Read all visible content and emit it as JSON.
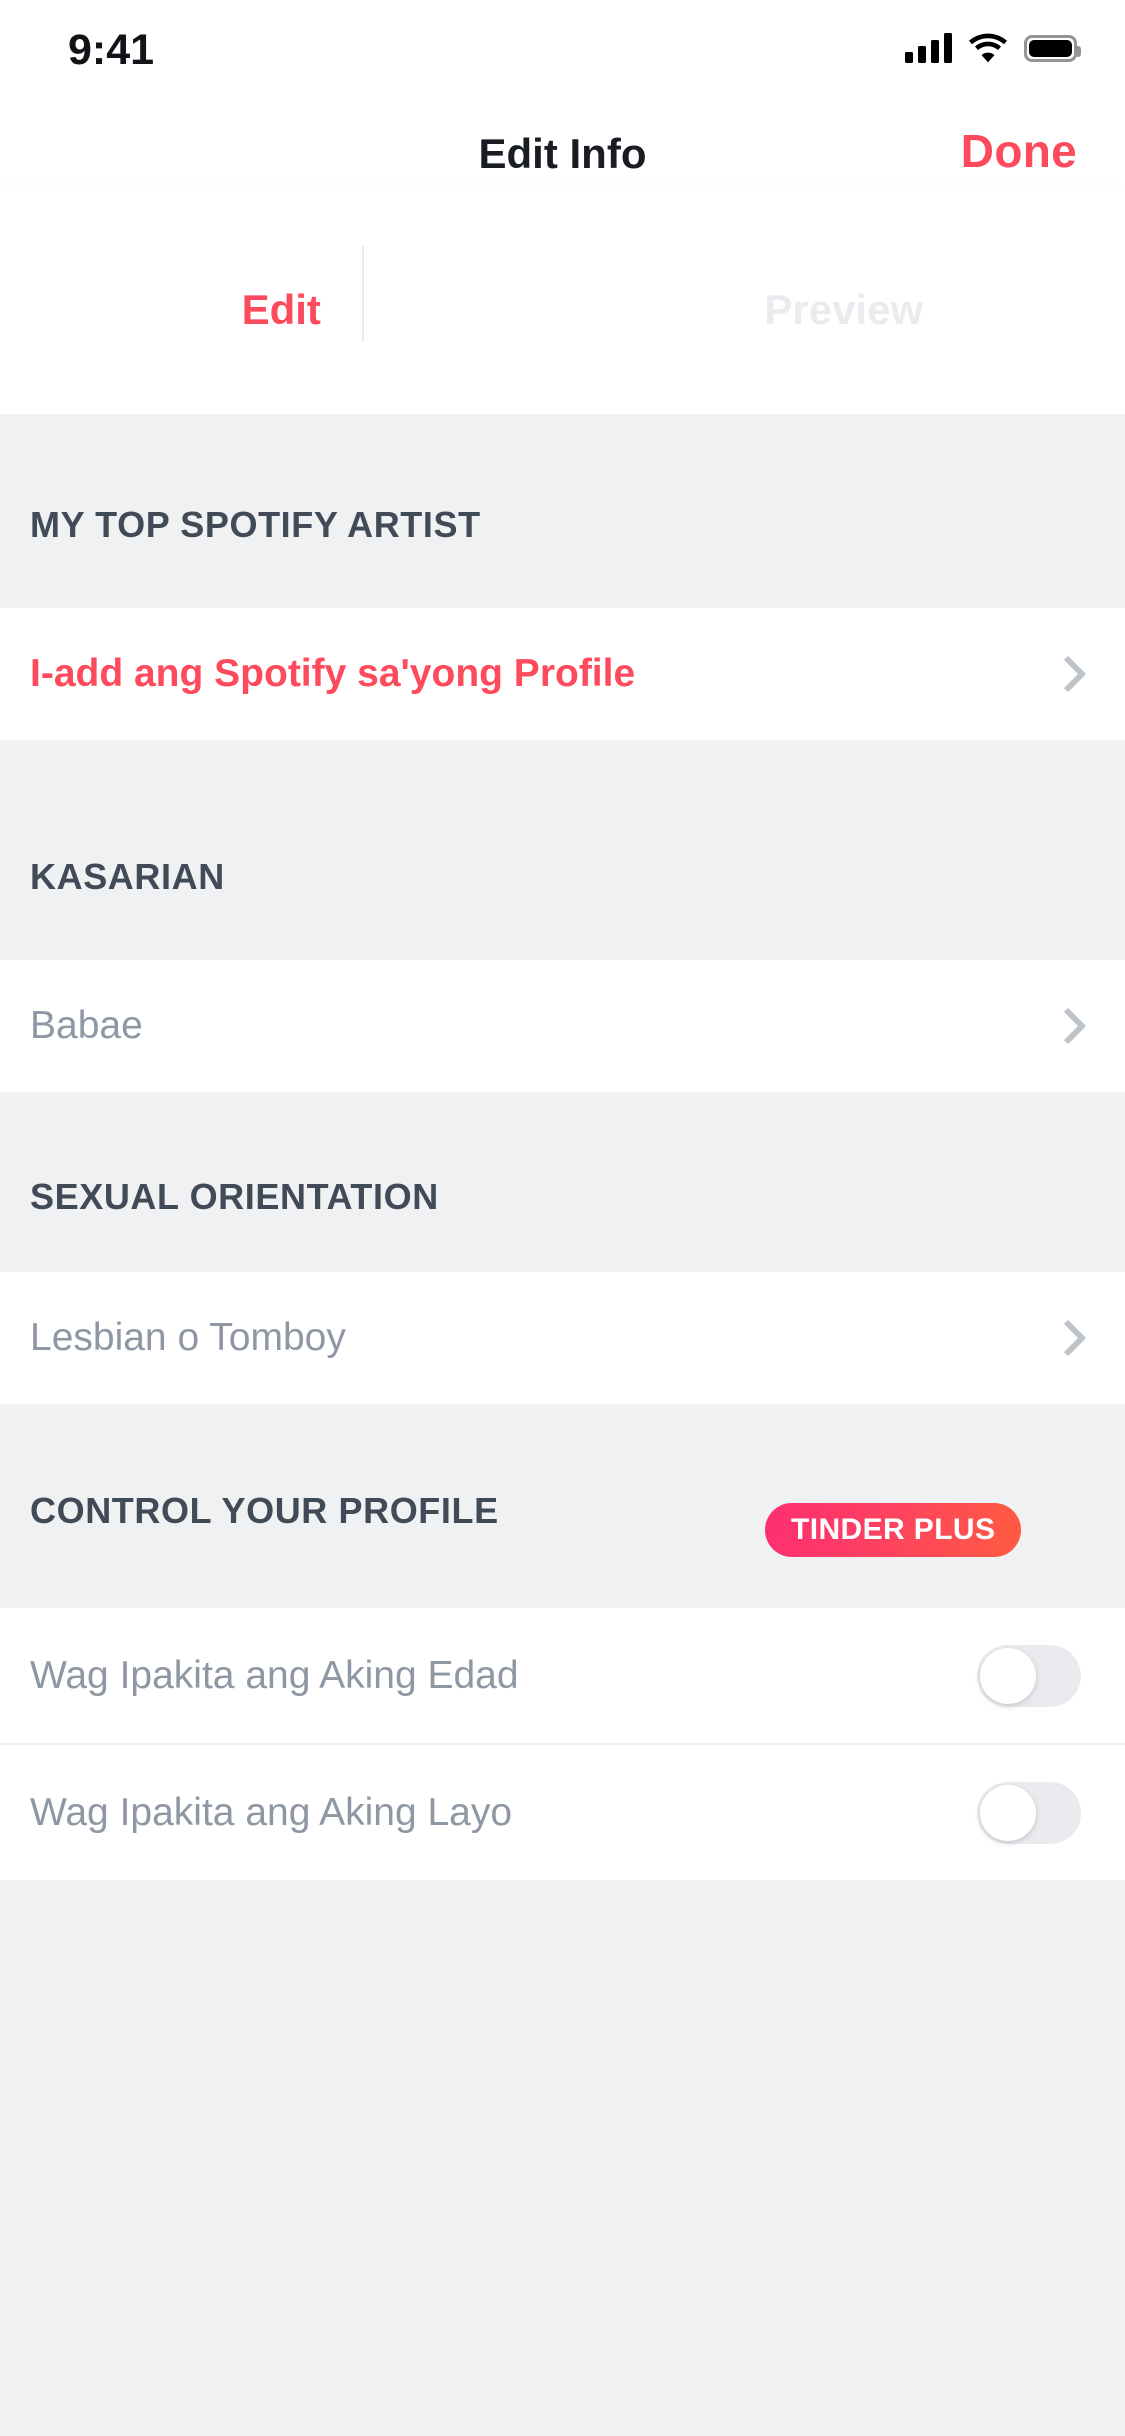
{
  "status_bar": {
    "time": "9:41",
    "icons": [
      "cellular-signal-icon",
      "wifi-icon",
      "battery-icon"
    ]
  },
  "nav": {
    "title": "Edit Info",
    "done_label": "Done"
  },
  "tabs": [
    {
      "label": "Edit",
      "active": true
    },
    {
      "label": "Preview",
      "active": false
    }
  ],
  "sections": [
    {
      "header": "MY TOP SPOTIFY ARTIST",
      "rows": [
        {
          "label": "I-add ang Spotify sa'yong Profile",
          "style": "accent",
          "control": "chevron"
        }
      ]
    },
    {
      "header": "KASARIAN",
      "rows": [
        {
          "label": "Babae",
          "style": "value",
          "control": "chevron"
        }
      ]
    },
    {
      "header": "SEXUAL ORIENTATION",
      "rows": [
        {
          "label": "Lesbian o Tomboy",
          "style": "value",
          "control": "chevron"
        }
      ]
    },
    {
      "header": "CONTROL YOUR PROFILE",
      "badge": "TINDER PLUS",
      "rows": [
        {
          "label": "Wag Ipakita ang Aking Edad",
          "style": "value",
          "control": "toggle",
          "toggle_on": false
        },
        {
          "label": "Wag Ipakita ang Aking Layo",
          "style": "value",
          "control": "toggle",
          "toggle_on": false
        }
      ]
    }
  ],
  "colors": {
    "accent": "#fd4a5c",
    "header_text": "#414a57",
    "value_text": "#8e97a3",
    "section_bg": "#eff1f3",
    "row_bg": "#ffffff",
    "badge_gradient_start": "#fd2e71",
    "badge_gradient_end": "#ff5b41",
    "toggle_track_off": "#e9ebee",
    "tab_inactive": "#e9ebee"
  }
}
